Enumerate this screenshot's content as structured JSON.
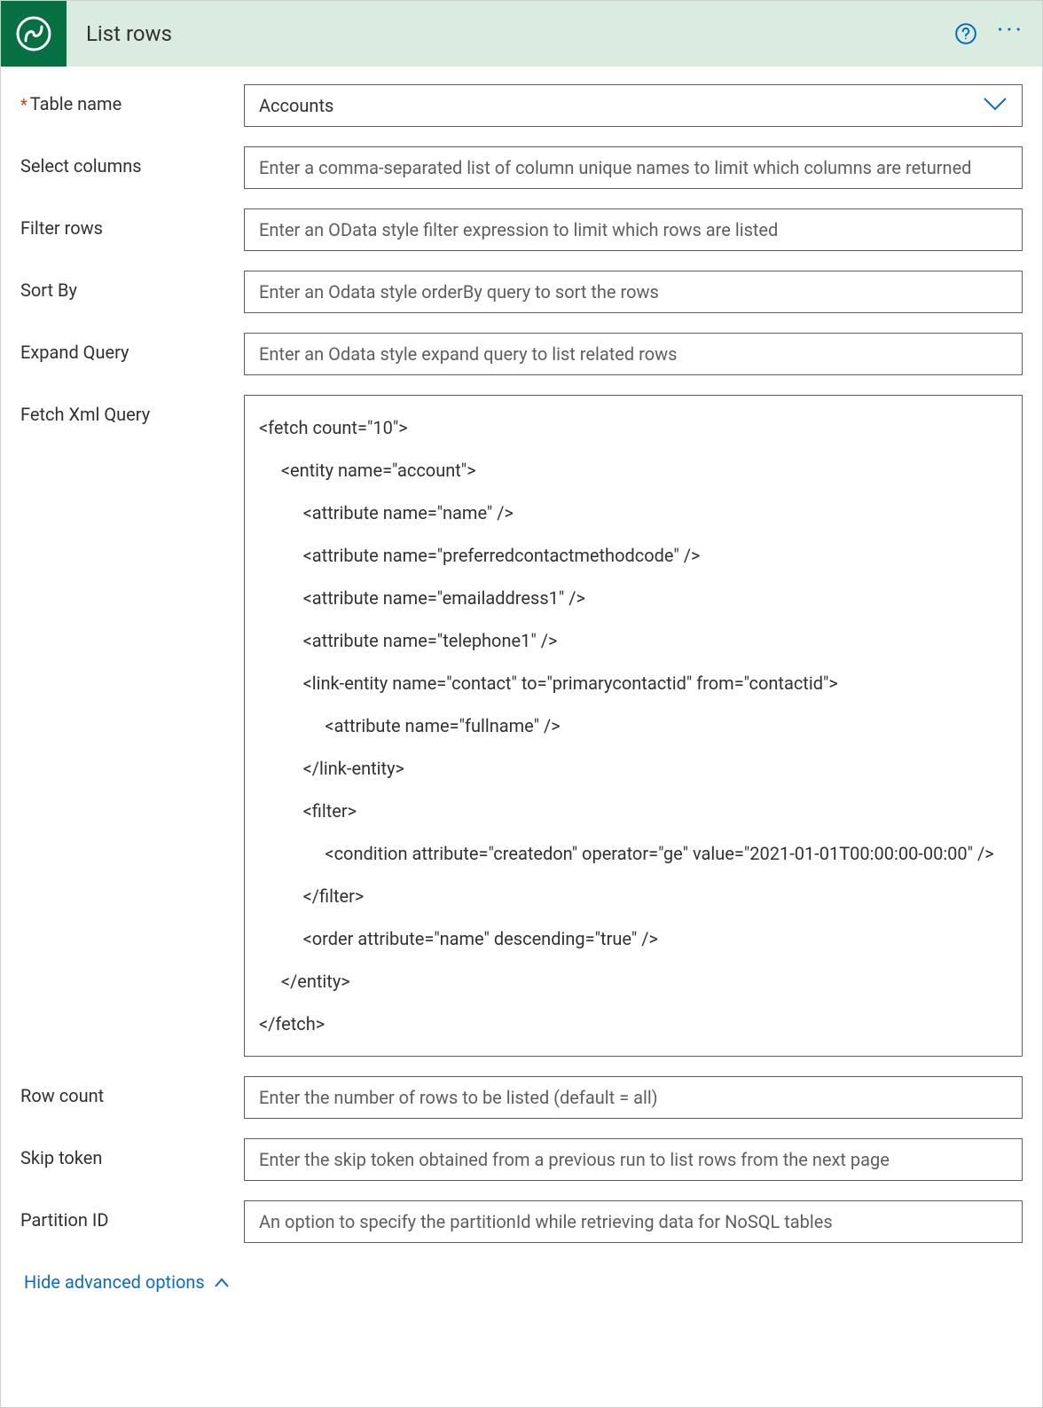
{
  "header": {
    "title": "List rows"
  },
  "fields": {
    "tableName": {
      "label": "Table name",
      "value": "Accounts"
    },
    "selectColumns": {
      "label": "Select columns",
      "placeholder": "Enter a comma-separated list of column unique names to limit which columns are returned"
    },
    "filterRows": {
      "label": "Filter rows",
      "placeholder": "Enter an OData style filter expression to limit which rows are listed"
    },
    "sortBy": {
      "label": "Sort By",
      "placeholder": "Enter an Odata style orderBy query to sort the rows"
    },
    "expandQuery": {
      "label": "Expand Query",
      "placeholder": "Enter an Odata style expand query to list related rows"
    },
    "fetchXml": {
      "label": "Fetch Xml Query",
      "value": "<fetch count=\"10\">\n     <entity name=\"account\">\n          <attribute name=\"name\" />\n          <attribute name=\"preferredcontactmethodcode\" />\n          <attribute name=\"emailaddress1\" />\n          <attribute name=\"telephone1\" />\n          <link-entity name=\"contact\" to=\"primarycontactid\" from=\"contactid\">\n               <attribute name=\"fullname\" />\n          </link-entity>\n          <filter>\n               <condition attribute=\"createdon\" operator=\"ge\" value=\"2021-01-01T00:00:00-00:00\" />\n          </filter>\n          <order attribute=\"name\" descending=\"true\" />\n     </entity>\n</fetch>"
    },
    "rowCount": {
      "label": "Row count",
      "placeholder": "Enter the number of rows to be listed (default = all)"
    },
    "skipToken": {
      "label": "Skip token",
      "placeholder": "Enter the skip token obtained from a previous run to list rows from the next page"
    },
    "partitionId": {
      "label": "Partition ID",
      "placeholder": "An option to specify the partitionId while retrieving data for NoSQL tables"
    }
  },
  "footer": {
    "toggleLabel": "Hide advanced options"
  }
}
